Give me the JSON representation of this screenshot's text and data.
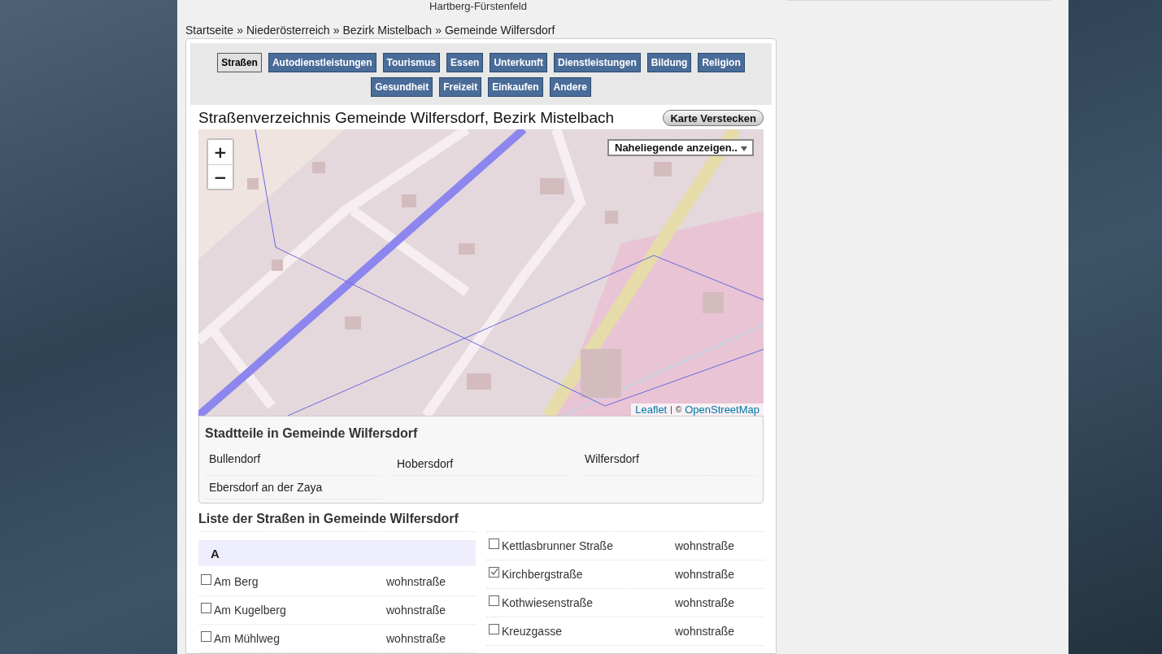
{
  "region_header": "Hartberg-Fürstenfeld",
  "breadcrumb": {
    "separator": "»",
    "items": [
      "Startseite",
      "Niederösterreich",
      "Bezirk Mistelbach",
      "Gemeinde Wilfersdorf"
    ]
  },
  "category_tabs": [
    {
      "label": "Straßen",
      "selected": true
    },
    {
      "label": "Autodienstleistungen",
      "selected": false
    },
    {
      "label": "Tourismus",
      "selected": false
    },
    {
      "label": "Essen",
      "selected": false
    },
    {
      "label": "Unterkunft",
      "selected": false
    },
    {
      "label": "Dienstleistungen",
      "selected": false
    },
    {
      "label": "Bildung",
      "selected": false
    },
    {
      "label": "Religion",
      "selected": false
    },
    {
      "label": "Gesundheit",
      "selected": false
    },
    {
      "label": "Freizeit",
      "selected": false
    },
    {
      "label": "Einkaufen",
      "selected": false
    },
    {
      "label": "Andere",
      "selected": false
    }
  ],
  "map_panel": {
    "title": "Straßenverzeichnis Gemeinde Wilfersdorf, Bezirk Mistelbach",
    "hide_button": "Karte Verstecken",
    "zoom_in": "+",
    "zoom_out": "−",
    "nearby_select": "Naheliegende anzeigen..",
    "attribution": {
      "leaflet": "Leaflet",
      "separator": "|",
      "copyright": "©",
      "osm": "OpenStreetMap"
    }
  },
  "districts": {
    "title": "Stadtteile in Gemeinde Wilfersdorf",
    "items": [
      "Bullendorf",
      "Hobersdorf",
      "Wilfersdorf",
      "Ebersdorf an der Zaya"
    ]
  },
  "street_list": {
    "title": "Liste der Straßen in Gemeinde Wilfersdorf",
    "columns": [
      [
        {
          "kind": "letter",
          "label": "A"
        },
        {
          "kind": "street",
          "name": "Am Berg",
          "type": "wohnstraße",
          "checked": false
        },
        {
          "kind": "street",
          "name": "Am Kugelberg",
          "type": "wohnstraße",
          "checked": false
        },
        {
          "kind": "street",
          "name": "Am Mühlweg",
          "type": "wohnstraße",
          "checked": false
        }
      ],
      [
        {
          "kind": "street",
          "name": "Kettlasbrunner Straße",
          "type": "wohnstraße",
          "checked": false
        },
        {
          "kind": "street",
          "name": "Kirchbergstraße",
          "type": "wohnstraße",
          "checked": true
        },
        {
          "kind": "street",
          "name": "Kothwiesenstraße",
          "type": "wohnstraße",
          "checked": false
        },
        {
          "kind": "street",
          "name": "Kreuzgasse",
          "type": "wohnstraße",
          "checked": false
        }
      ]
    ]
  }
}
